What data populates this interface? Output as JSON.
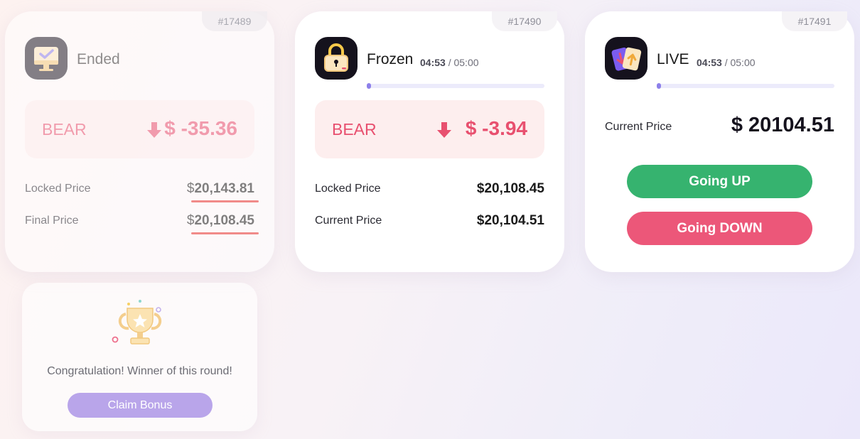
{
  "cards": [
    {
      "round_id": "#17489",
      "status": "Ended",
      "position": "BEAR",
      "change": "$ -35.36",
      "locked_label": "Locked Price",
      "locked_currency": "$",
      "locked_value": "20,143.81",
      "final_label": "Final Price",
      "final_currency": "$",
      "final_value": "20,108.45"
    },
    {
      "round_id": "#17490",
      "status": "Frozen",
      "timer_elapsed": "04:53",
      "timer_total": "/ 05:00",
      "progress_fraction": 0.02,
      "position": "BEAR",
      "change": "$ -3.94",
      "locked_label": "Locked Price",
      "locked_value": "$20,108.45",
      "current_label": "Current Price",
      "current_value": "$20,104.51"
    },
    {
      "round_id": "#17491",
      "status": "LIVE",
      "timer_elapsed": "04:53",
      "timer_total": "/ 05:00",
      "progress_fraction": 0.02,
      "current_label": "Current Price",
      "current_value": "$ 20104.51",
      "up_label": "Going UP",
      "down_label": "Going DOWN"
    }
  ],
  "bonus": {
    "message": "Congratulation! Winner of this round!",
    "claim_label": "Claim Bonus"
  },
  "colors": {
    "bear": "#e8506f",
    "up_button": "#36b36f",
    "down_button": "#ec5779",
    "claim_button": "#b9a5ea",
    "progress": "#8d80ea",
    "highlight_underline": "#e8322e"
  },
  "icons": {
    "ended": "monitor-check-icon",
    "frozen": "padlock-icon",
    "live": "cards-up-down-icon",
    "bear": "arrow-down-icon",
    "bonus": "trophy-icon"
  }
}
